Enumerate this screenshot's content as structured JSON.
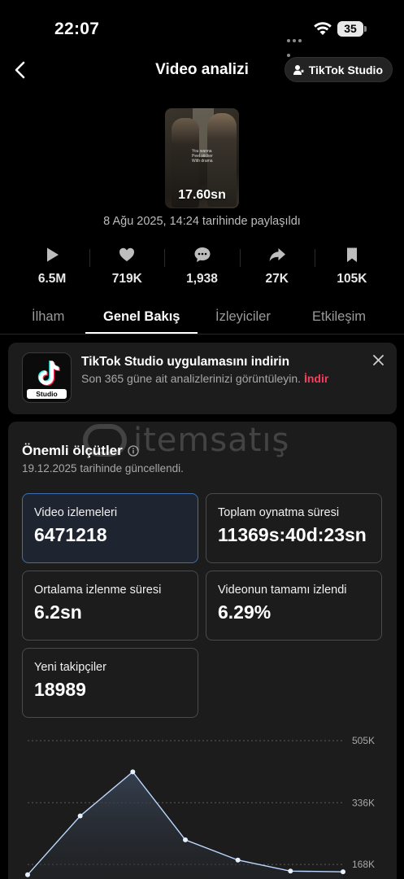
{
  "status": {
    "time": "22:07",
    "battery": "35"
  },
  "header": {
    "title": "Video analizi",
    "studio_button": "TikTok Studio"
  },
  "video": {
    "duration": "17.60sn",
    "posted": "8 Ağu 2025, 14:24 tarihinde paylaşıldı",
    "caption_lines": [
      "You wanna",
      "Peel sticker",
      "With drama"
    ]
  },
  "stats": [
    {
      "icon": "play-icon",
      "value": "6.5M"
    },
    {
      "icon": "heart-icon",
      "value": "719K"
    },
    {
      "icon": "comment-icon",
      "value": "1,938"
    },
    {
      "icon": "share-icon",
      "value": "27K"
    },
    {
      "icon": "bookmark-icon",
      "value": "105K"
    }
  ],
  "tabs": [
    {
      "label": "İlham",
      "active": false
    },
    {
      "label": "Genel Bakış",
      "active": true
    },
    {
      "label": "İzleyiciler",
      "active": false
    },
    {
      "label": "Etkileşim",
      "active": false
    }
  ],
  "banner": {
    "app_label": "Studio",
    "title": "TikTok Studio uygulamasını indirin",
    "text": "Son 365 güne ait analizlerinizi görüntüleyin.",
    "download": "İndir"
  },
  "watermark": {
    "text": "itemsatış"
  },
  "metrics": {
    "title": "Önemli ölçütler",
    "updated": "19.12.2025 tarihinde güncellendi.",
    "items": [
      {
        "label": "Video izlemeleri",
        "value": "6471218",
        "selected": true
      },
      {
        "label": "Toplam oynatma süresi",
        "value": "11369s:40d:23sn",
        "selected": false
      },
      {
        "label": "Ortalama izlenme süresi",
        "value": "6.2sn",
        "selected": false
      },
      {
        "label": "Videonun tamamı izlendi",
        "value": "6.29%",
        "selected": false
      },
      {
        "label": "Yeni takipçiler",
        "value": "18989",
        "selected": false
      }
    ]
  },
  "colors": {
    "accent": "#ff3b5c",
    "selected_border": "#3f6fb0",
    "chart_line": "#bcd8ff"
  },
  "chart_data": {
    "type": "area",
    "y_tick_labels": [
      "505K",
      "336K",
      "168K"
    ],
    "y_ticks": [
      505000,
      336000,
      168000
    ],
    "ylim": [
      0,
      505000
    ],
    "grid": true,
    "series": [
      {
        "values": [
          140000,
          300000,
          420000,
          235000,
          180000,
          150000,
          148000
        ]
      }
    ]
  }
}
